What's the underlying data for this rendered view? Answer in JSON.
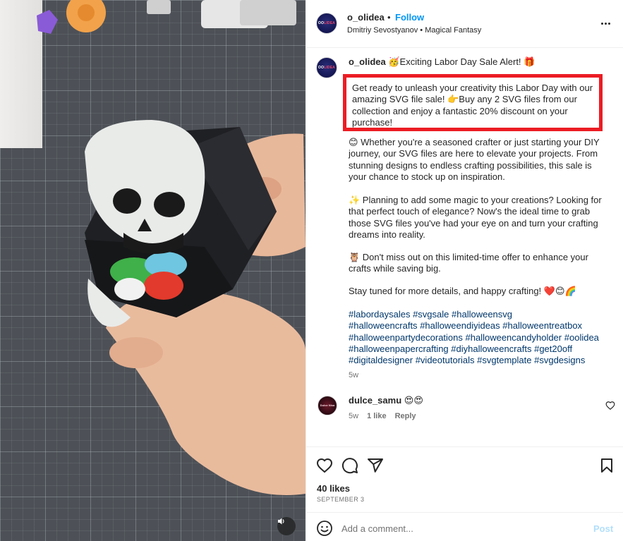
{
  "post": {
    "author": "o_olidea",
    "follow_label": "Follow",
    "separator": "•",
    "audio_info": "Dmitriy Sevostyanov • Magical Fantasy",
    "avatar_text": "OO",
    "avatar_text_accent": "LIDEA"
  },
  "caption": {
    "username": "o_olidea",
    "headline": "🥳Exciting Labor Day Sale Alert! 🎁",
    "highlighted": "Get ready to unleash your creativity this Labor Day with our amazing SVG file sale! 👉Buy any 2 SVG files from our collection and enjoy a fantastic 20% discount on your purchase!",
    "paragraphs": [
      "😊 Whether you're a seasoned crafter or just starting your DIY journey, our SVG files are here to elevate your projects. From stunning designs to endless crafting possibilities, this sale is your chance to stock up on inspiration.",
      "✨ Planning to add some magic to your creations? Looking for that perfect touch of elegance? Now's the ideal time to grab those SVG files you've had your eye on and turn your crafting dreams into reality.",
      "🦉 Don't miss out on this limited-time offer to enhance your crafts while saving big.",
      "Stay tuned for more details, and happy crafting! ❤️😊🌈"
    ],
    "hashtags": [
      "#labordaysales",
      "#svgsale",
      "#halloweensvg",
      "#halloweencrafts",
      "#halloweendiyideas",
      "#halloweentreatbox",
      "#halloweenpartydecorations",
      "#halloweencandyholder",
      "#oolidea",
      "#halloweenpapercrafting",
      "#diyhalloweencrafts",
      "#get20off",
      "#digitaldesigner",
      "#videotutorials",
      "#svgtemplate",
      "#svgdesigns"
    ],
    "time": "5w"
  },
  "comment": {
    "username": "dulce_samu",
    "text": "😍😍",
    "time": "5w",
    "likes": "1 like",
    "reply": "Reply",
    "avatar_text": "Dulce Nisa"
  },
  "actions": {
    "likes": "40 likes",
    "date": "SEPTEMBER 3",
    "comment_placeholder": "Add a comment...",
    "post_label": "Post"
  },
  "icons": {
    "like": "heart-icon",
    "comment": "comment-bubble-icon",
    "share": "paper-plane-icon",
    "save": "bookmark-icon",
    "emoji": "smiley-icon",
    "more": "more-options-icon",
    "volume": "speaker-icon"
  },
  "colors": {
    "link": "#0095f6",
    "hashtag": "#00376b",
    "highlight_box": "#ec1c24",
    "muted_text": "#737373",
    "post_disabled": "#b2dffc"
  }
}
